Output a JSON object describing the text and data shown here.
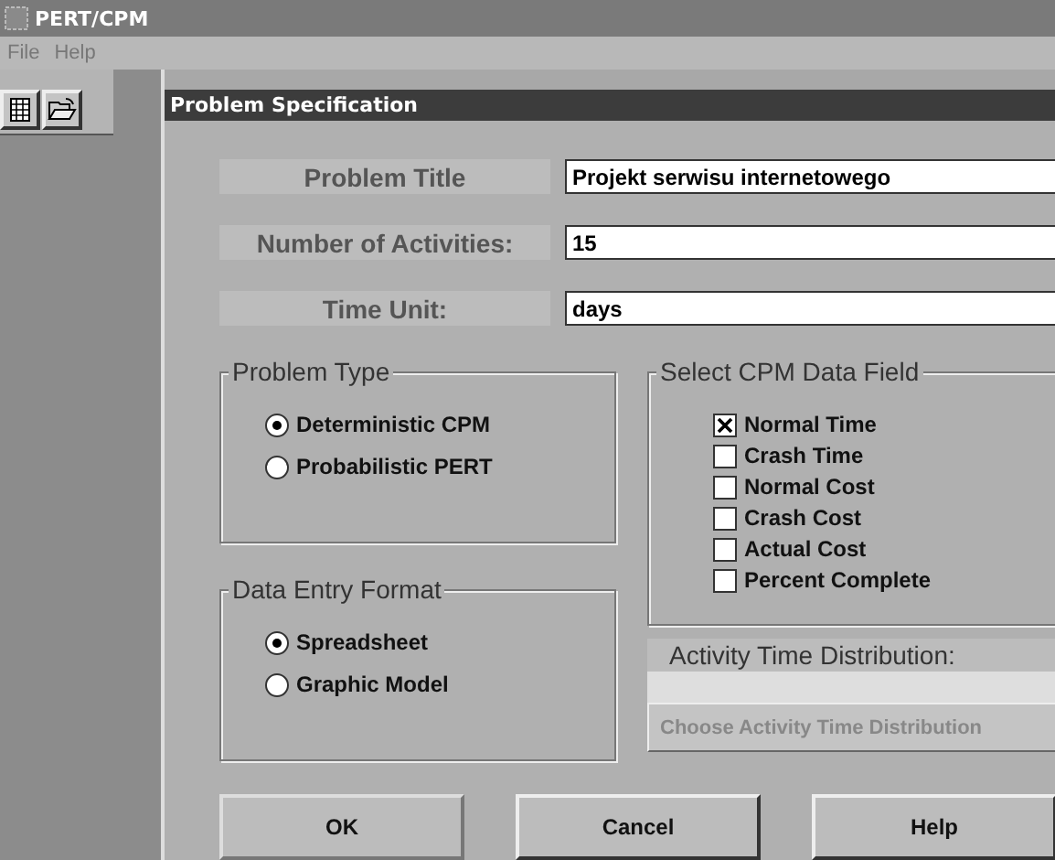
{
  "window": {
    "title": "PERT/CPM"
  },
  "menu": [
    "File",
    "Help"
  ],
  "dialog": {
    "title": "Problem Specification",
    "fields": [
      {
        "label": "Problem Title",
        "value": "Projekt serwisu internetowego"
      },
      {
        "label": "Number of Activities:",
        "value": "15"
      },
      {
        "label": "Time Unit:",
        "value": "days"
      }
    ],
    "problem_type": {
      "title": "Problem Type",
      "options": [
        {
          "label": "Deterministic CPM",
          "selected": true
        },
        {
          "label": "Probabilistic PERT",
          "selected": false
        }
      ]
    },
    "data_entry_format": {
      "title": "Data Entry Format",
      "options": [
        {
          "label": "Spreadsheet",
          "selected": true
        },
        {
          "label": "Graphic Model",
          "selected": false
        }
      ]
    },
    "cpm_data_field": {
      "title": "Select CPM Data Field",
      "items": [
        {
          "label": "Normal Time",
          "checked": true
        },
        {
          "label": "Crash Time",
          "checked": false
        },
        {
          "label": "Normal Cost",
          "checked": false
        },
        {
          "label": "Crash Cost",
          "checked": false
        },
        {
          "label": "Actual Cost",
          "checked": false
        },
        {
          "label": "Percent Complete",
          "checked": false
        }
      ]
    },
    "activity_time_distribution": {
      "label": "Activity Time Distribution:",
      "button": {
        "label": "Choose Activity Time Distribution",
        "disabled": true
      }
    },
    "buttons": [
      "OK",
      "Cancel",
      "Help"
    ]
  }
}
